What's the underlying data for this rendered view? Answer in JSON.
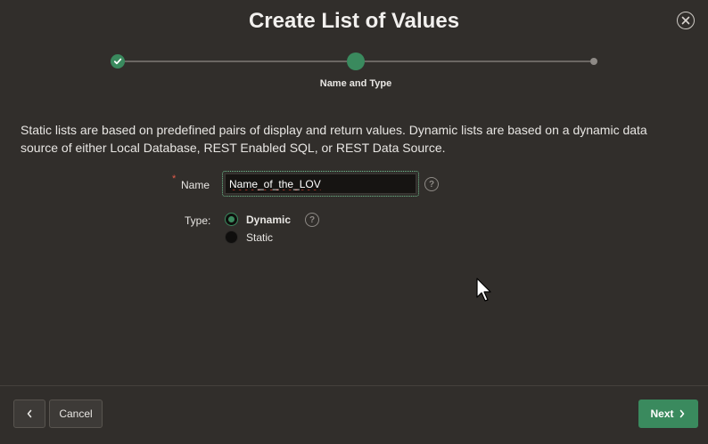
{
  "dialog": {
    "title": "Create List of Values",
    "close_icon": "close-icon"
  },
  "wizard": {
    "steps": [
      {
        "status": "complete"
      },
      {
        "status": "current",
        "label": "Name and Type"
      },
      {
        "status": "future"
      }
    ]
  },
  "description": "Static lists are based on predefined pairs of display and return values. Dynamic lists are based on a dynamic data source of either Local Database, REST Enabled SQL, or REST Data Source.",
  "form": {
    "name": {
      "required_marker": "*",
      "label": "Name",
      "value": "Name_of_the_LOV",
      "help_icon": "?"
    },
    "type": {
      "label": "Type:",
      "help_icon": "?",
      "options": [
        {
          "label": "Dynamic",
          "selected": true
        },
        {
          "label": "Static",
          "selected": false
        }
      ]
    }
  },
  "footer": {
    "previous_icon": "chevron-left-icon",
    "cancel_label": "Cancel",
    "next_label": "Next",
    "next_icon": "chevron-right-icon"
  },
  "colors": {
    "background": "#312e2b",
    "accent": "#3a8a5e",
    "required": "#e45c4a"
  }
}
